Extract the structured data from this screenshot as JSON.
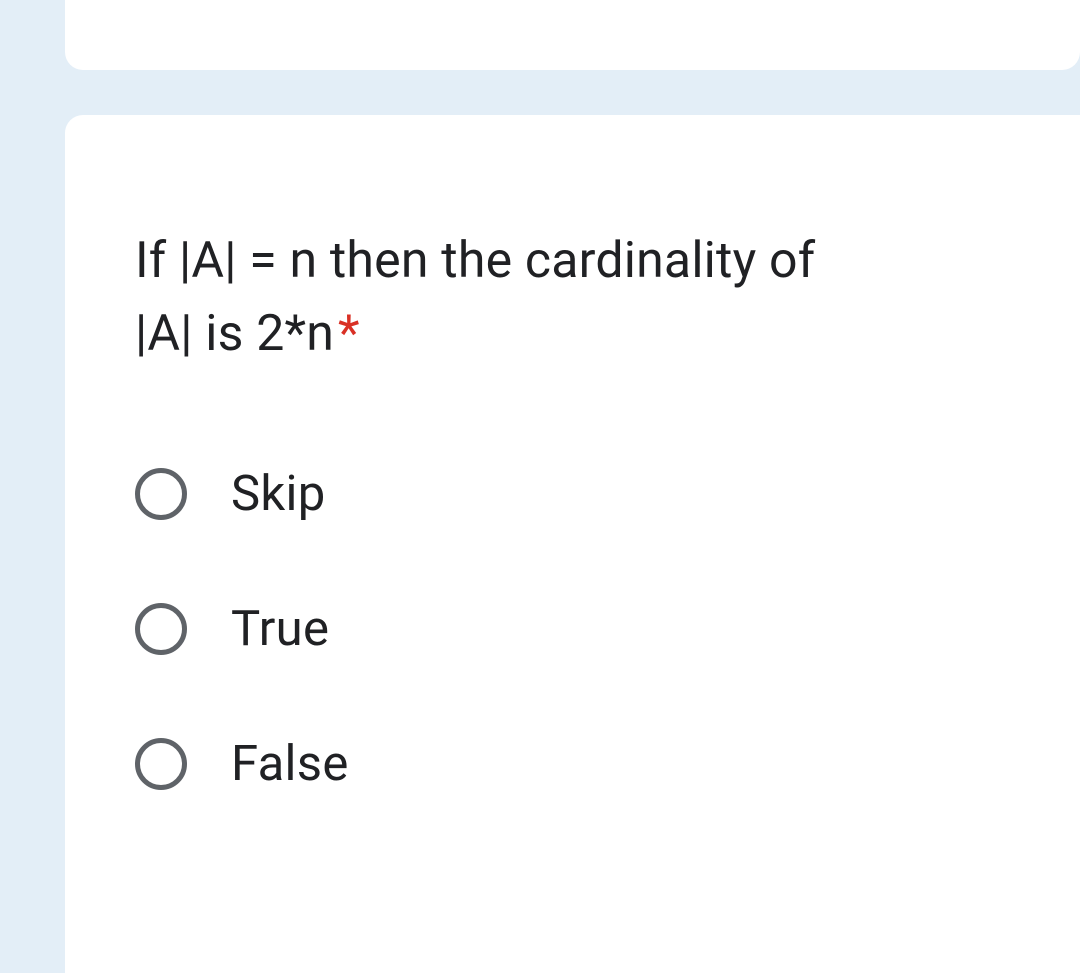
{
  "question": {
    "text_line1": "If |A| = n then the cardinality of",
    "text_line2": "|A| is 2*n",
    "required_marker": "*"
  },
  "options": [
    {
      "label": "Skip"
    },
    {
      "label": "True"
    },
    {
      "label": "False"
    }
  ]
}
